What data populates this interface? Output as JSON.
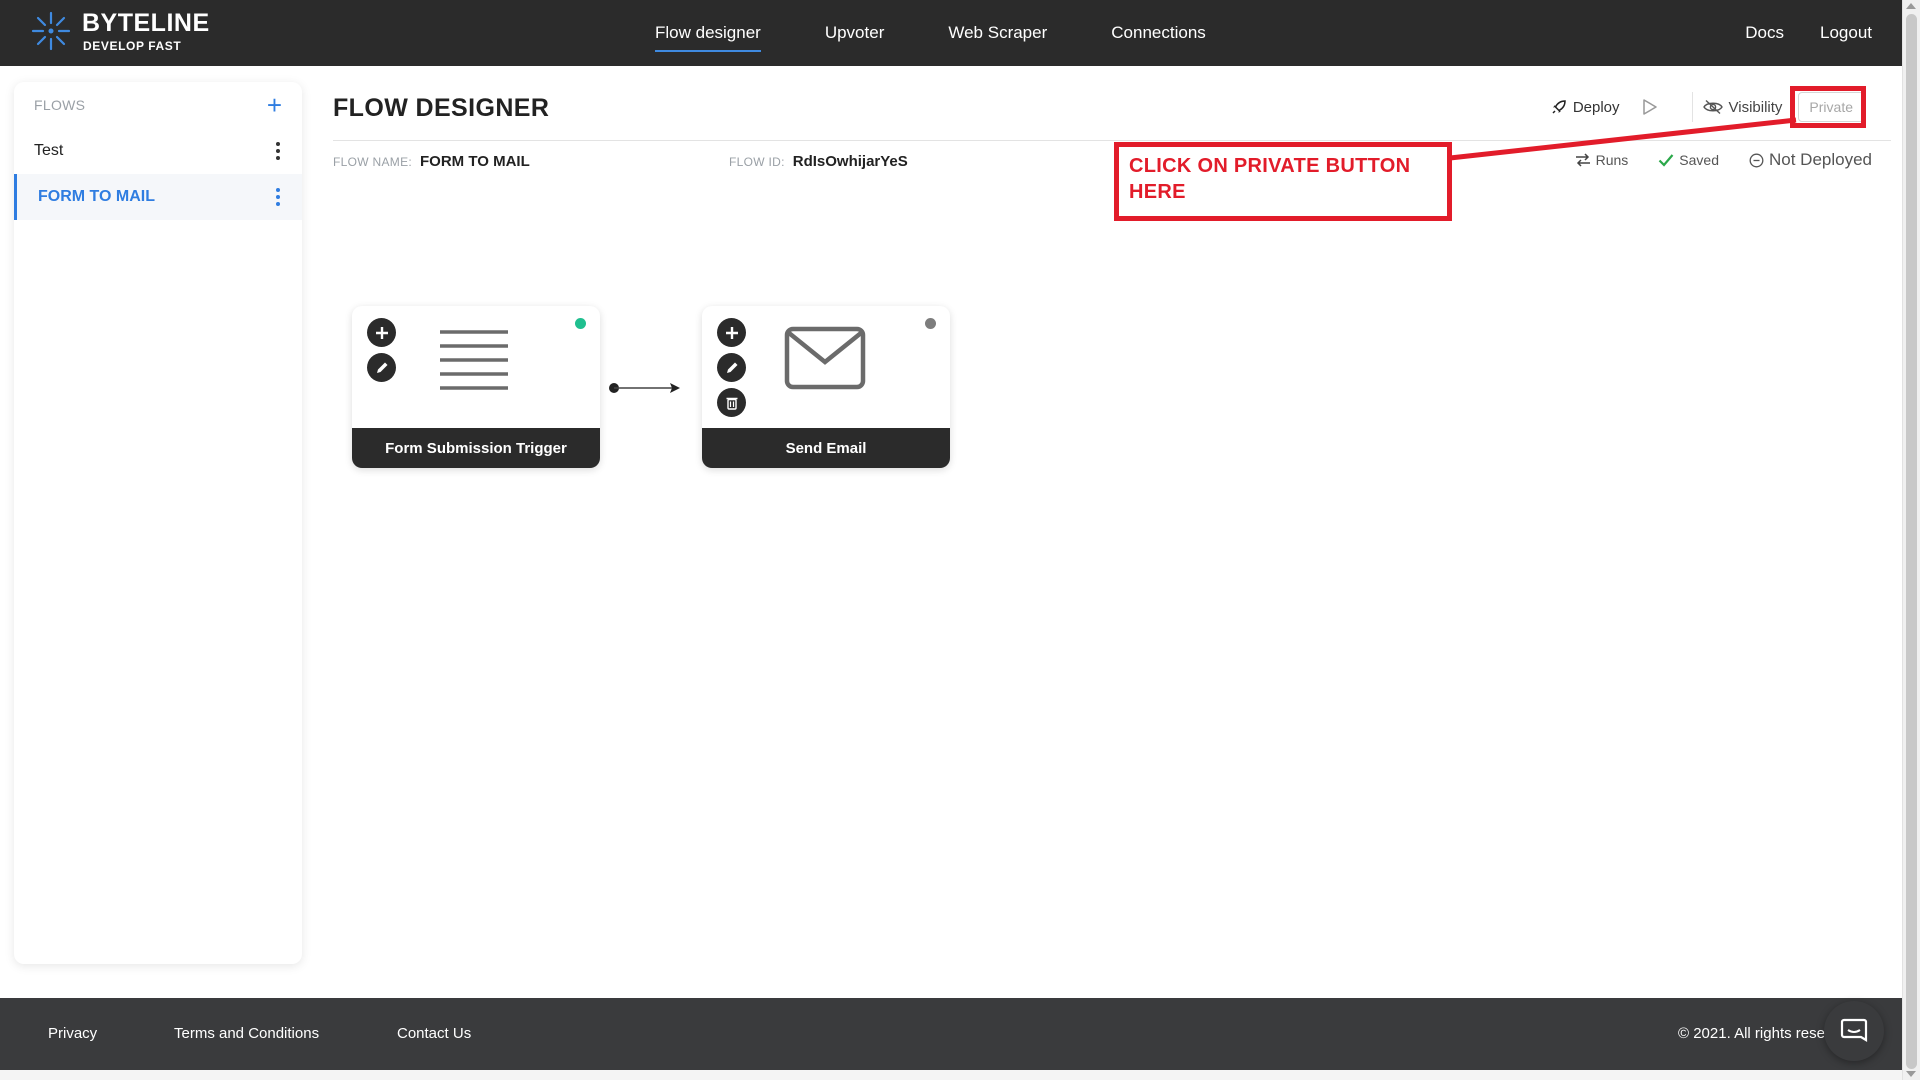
{
  "brand": {
    "name": "BYTELINE",
    "tagline": "DEVELOP FAST",
    "accent": "#2f7de1"
  },
  "nav": {
    "items": [
      {
        "label": "Flow designer",
        "active": true
      },
      {
        "label": "Upvoter"
      },
      {
        "label": "Web Scraper"
      },
      {
        "label": "Connections"
      }
    ],
    "right": [
      {
        "label": "Docs"
      },
      {
        "label": "Logout"
      }
    ]
  },
  "sidebar": {
    "header": "FLOWS",
    "add_icon": "plus-icon",
    "items": [
      {
        "label": "Test",
        "active": false
      },
      {
        "label": "FORM TO MAIL",
        "active": true
      }
    ]
  },
  "main": {
    "title": "FLOW DESIGNER",
    "flow_name_label": "FLOW NAME:",
    "flow_name": "FORM TO MAIL",
    "flow_id_label": "FLOW ID:",
    "flow_id": "RdIsOwhijarYeS",
    "toolbar": {
      "deploy": "Deploy",
      "play_icon": "play-icon",
      "visibility": "Visibility",
      "private": "Private"
    },
    "status": {
      "runs": "Runs",
      "saved": "Saved",
      "deployed": "Not Deployed"
    }
  },
  "annotation": {
    "text": "CLICK ON PRIVATE BUTTON HERE",
    "color": "#e21c2a"
  },
  "nodes": [
    {
      "title": "Form Submission Trigger",
      "icon": "form-lines-icon",
      "status_color": "#1fbf8f"
    },
    {
      "title": "Send Email",
      "icon": "envelope-icon",
      "status_color": "#7d7d7d"
    }
  ],
  "footer": {
    "privacy": "Privacy",
    "terms": "Terms and Conditions",
    "contact": "Contact Us",
    "copyright": "© 2021. All rights reserved."
  }
}
